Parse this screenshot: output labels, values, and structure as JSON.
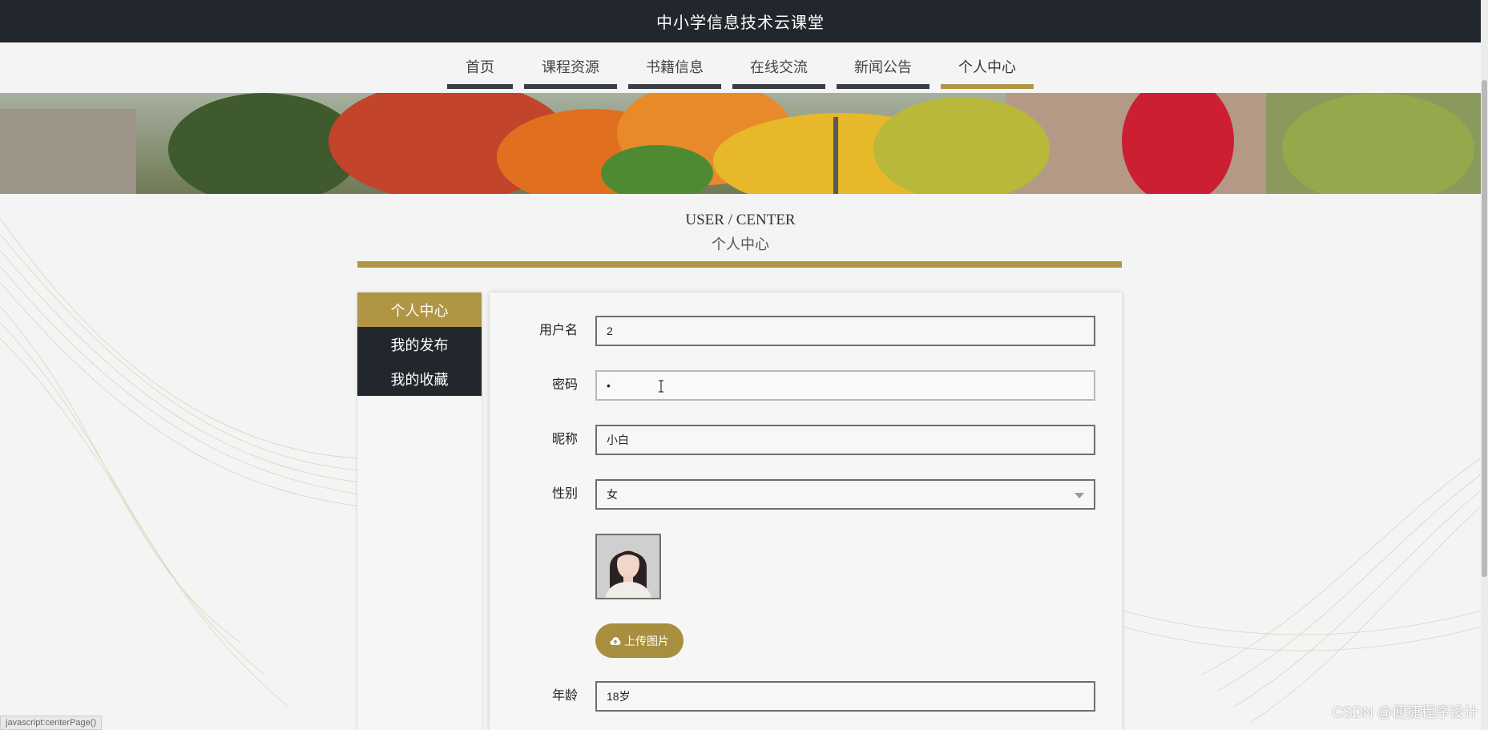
{
  "header": {
    "title": "中小学信息技术云课堂"
  },
  "nav": {
    "items": [
      {
        "label": "首页"
      },
      {
        "label": "课程资源"
      },
      {
        "label": "书籍信息"
      },
      {
        "label": "在线交流"
      },
      {
        "label": "新闻公告"
      },
      {
        "label": "个人中心",
        "active": true
      }
    ]
  },
  "section": {
    "title_en": "USER / CENTER",
    "title_cn": "个人中心"
  },
  "sidebar": {
    "items": [
      {
        "label": "个人中心",
        "active": true
      },
      {
        "label": "我的发布"
      },
      {
        "label": "我的收藏"
      }
    ]
  },
  "form": {
    "username": {
      "label": "用户名",
      "value": "2"
    },
    "password": {
      "label": "密码",
      "value": "•"
    },
    "nickname": {
      "label": "昵称",
      "value": "小白"
    },
    "gender": {
      "label": "性别",
      "value": "女"
    },
    "upload_label": "上传图片",
    "age": {
      "label": "年龄",
      "value": "18岁"
    }
  },
  "status_bar": {
    "url": "javascript:centerPage()"
  },
  "watermark": "CSDN @便捷程序设计",
  "colors": {
    "accent": "#b09545",
    "dark": "#22262d"
  }
}
